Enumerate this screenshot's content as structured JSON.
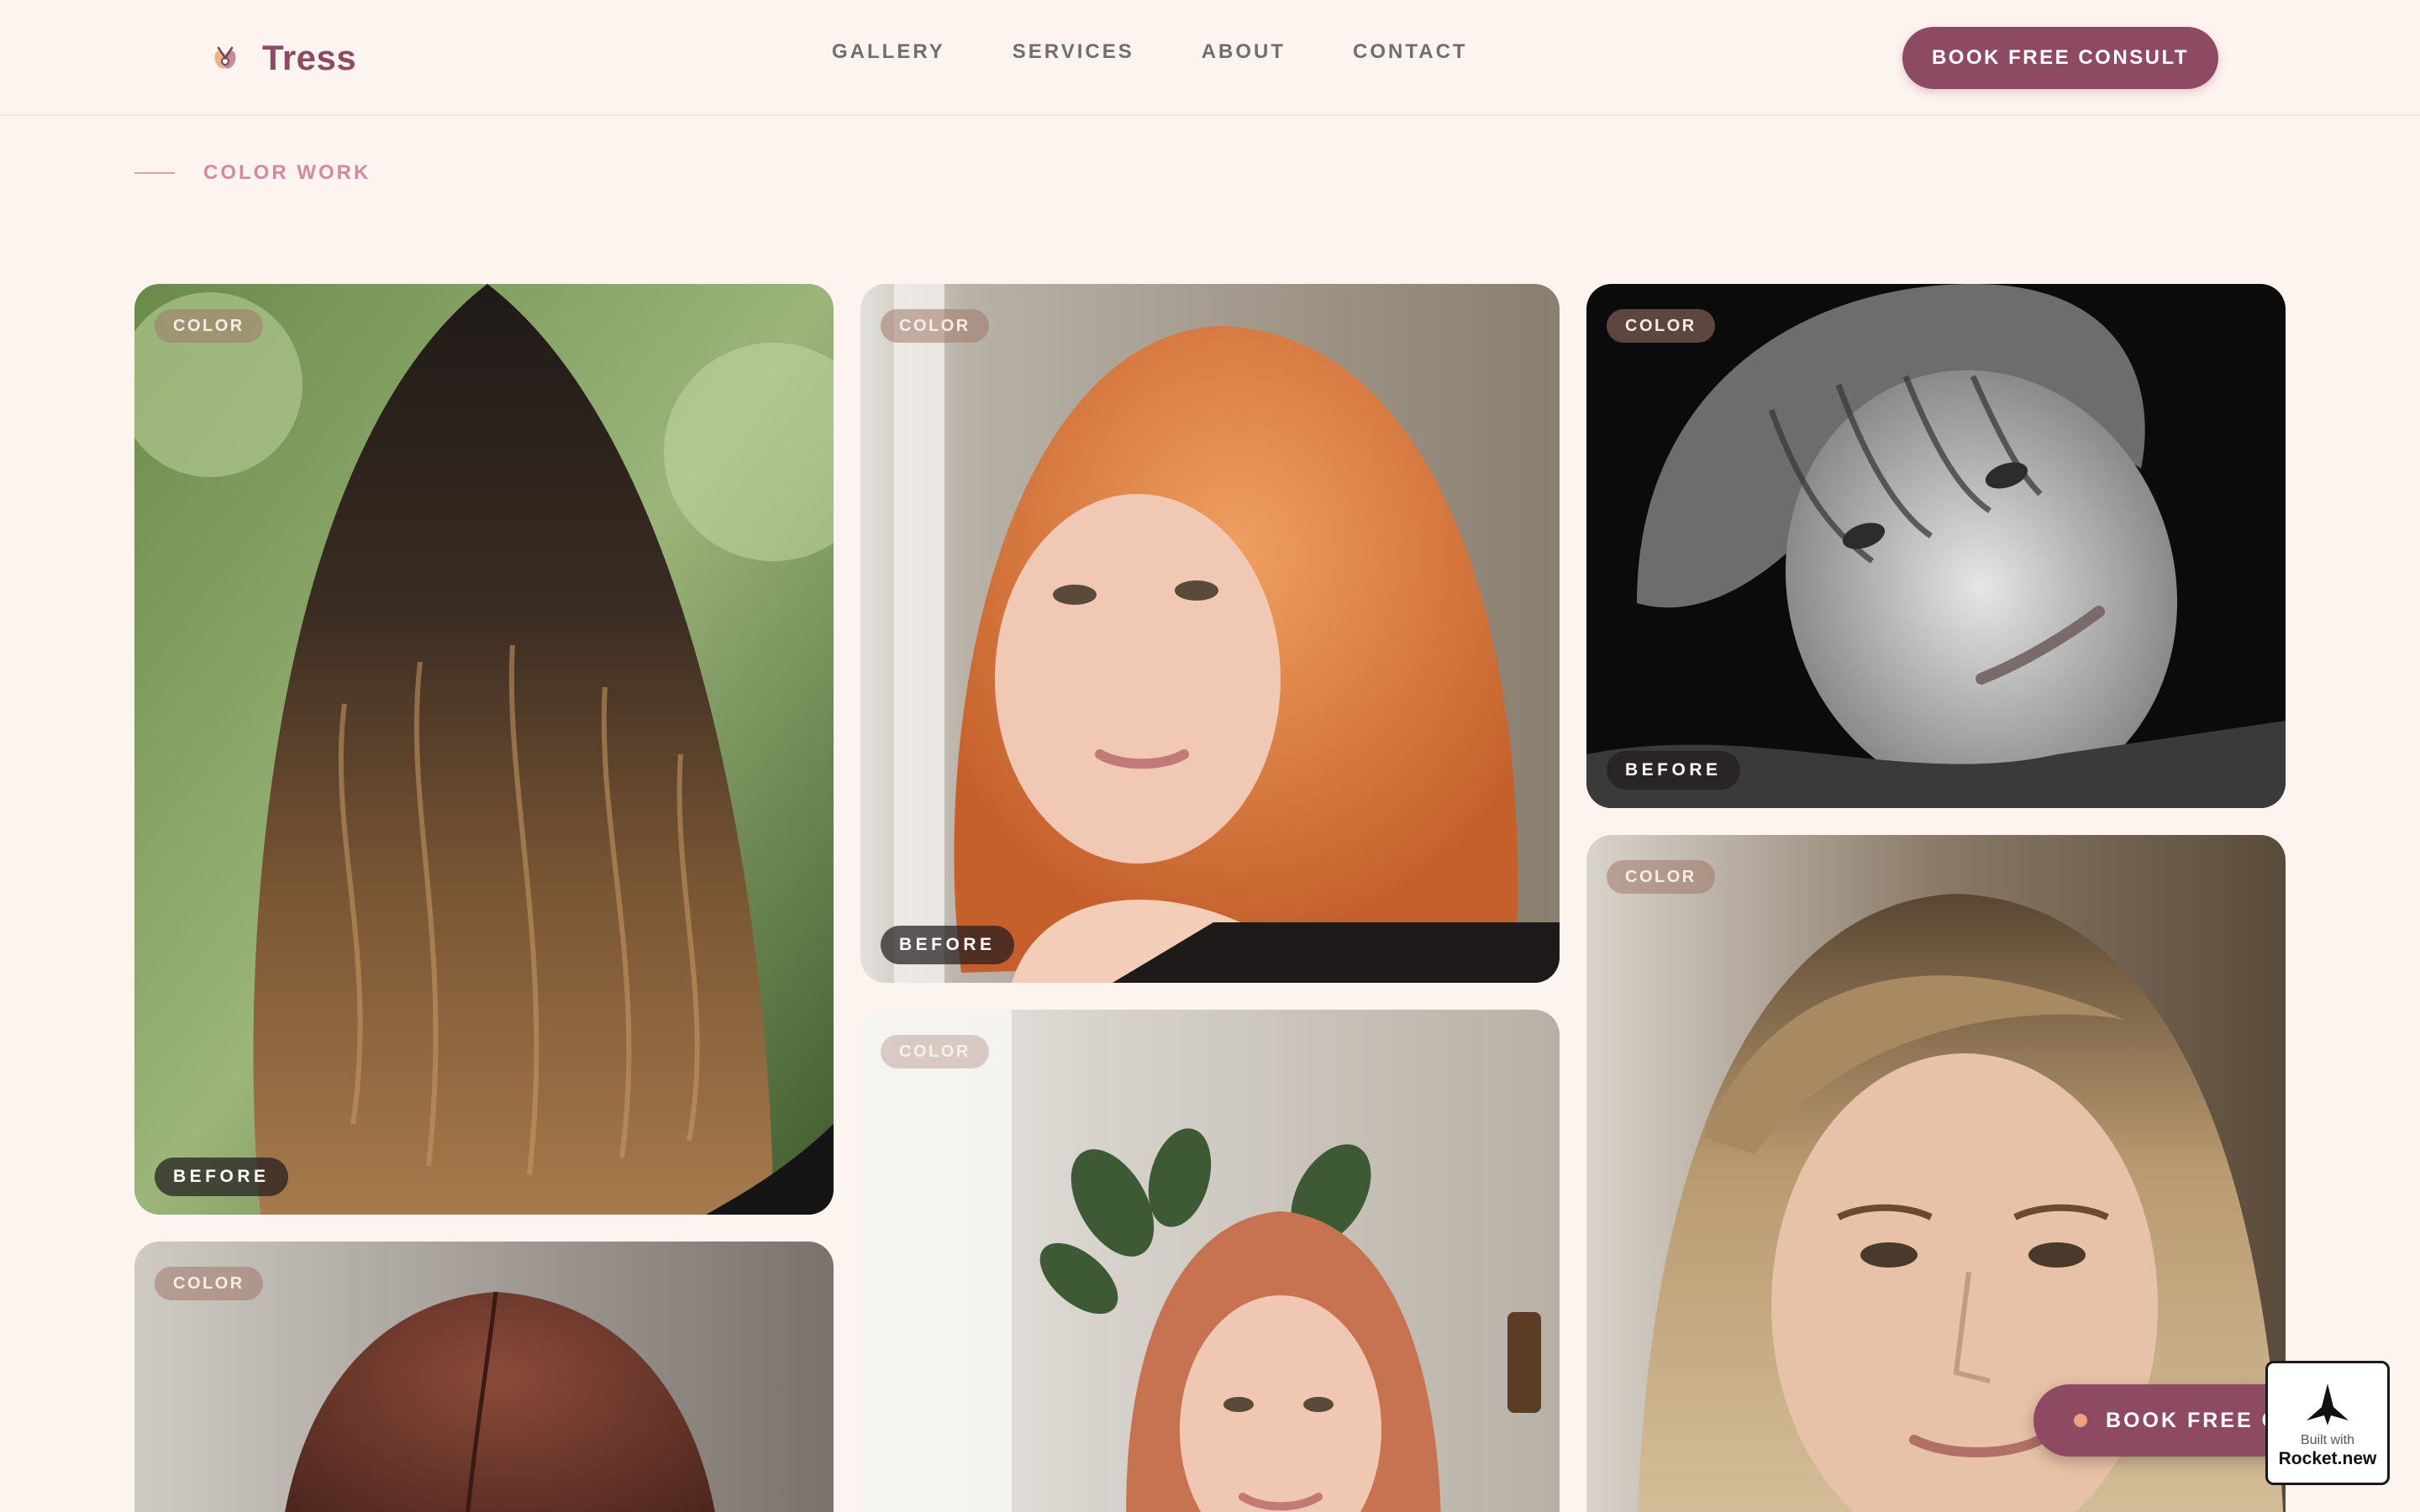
{
  "brand": {
    "name": "Tress",
    "logo_icon": "scissors-flower-icon"
  },
  "nav": {
    "items": [
      {
        "label": "GALLERY"
      },
      {
        "label": "SERVICES"
      },
      {
        "label": "ABOUT"
      },
      {
        "label": "CONTACT"
      }
    ],
    "cta_label": "BOOK FREE CONSULT"
  },
  "section": {
    "label": "COLOR WORK"
  },
  "gallery": {
    "cards": [
      {
        "category": "COLOR",
        "stage": "BEFORE",
        "subject": "long dark hair with caramel balayage, back view"
      },
      {
        "category": "COLOR",
        "stage": "BEFORE",
        "subject": "copper-orange lob portrait"
      },
      {
        "category": "COLOR",
        "stage": "BEFORE",
        "subject": "black and white portrait with fringe"
      },
      {
        "category": "COLOR",
        "stage": "",
        "subject": "auburn brown hair, top of head"
      },
      {
        "category": "COLOR",
        "stage": "",
        "subject": "strawberry copper hair portrait"
      },
      {
        "category": "COLOR",
        "stage": "",
        "subject": "blonde balayage portrait"
      }
    ]
  },
  "floating_cta": {
    "label": "BOOK FREE CONSULT",
    "dot_color": "#f0a07e"
  },
  "badge": {
    "line1": "Built with",
    "line2": "Rocket.new",
    "icon": "rocket-icon"
  },
  "colors": {
    "accent": "#8e4a62",
    "background": "#fdf4ef",
    "section_label": "#d28aa0"
  }
}
